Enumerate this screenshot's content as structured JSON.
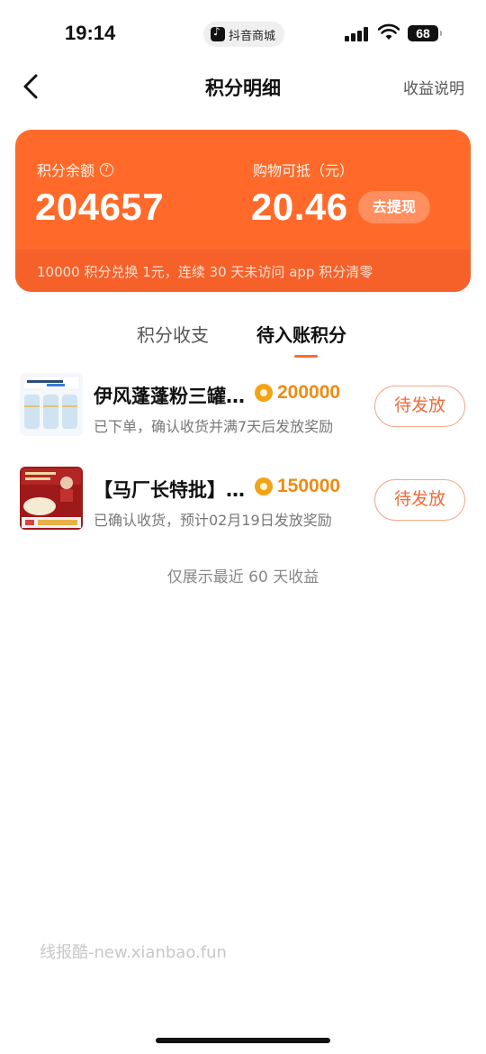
{
  "status_bar": {
    "time": "19:14",
    "app_pill": "抖音商城",
    "battery": "68"
  },
  "nav": {
    "title": "积分明细",
    "right_link": "收益说明"
  },
  "card": {
    "balance_label": "积分余额",
    "balance_value": "204657",
    "cash_label": "购物可抵（元）",
    "cash_value": "20.46",
    "withdraw_label": "去提现",
    "footnote": "10000 积分兑换 1元，连续 30 天未访问 app 积分清零"
  },
  "tabs": [
    {
      "label": "积分收支",
      "active": false
    },
    {
      "label": "待入账积分",
      "active": true
    }
  ],
  "items": [
    {
      "title": "伊风蓬蓬粉三罐装小蓝罐",
      "points": "200000",
      "subtitle": "已下单，确认收货并满7天后发放奖励",
      "button": "待发放"
    },
    {
      "title": "【马厂长特批】酸菜饺子",
      "points": "150000",
      "subtitle": "已确认收货，预计02月19日发放奖励",
      "button": "待发放"
    }
  ],
  "footer_note": "仅展示最近 60 天收益",
  "watermark": "线报酷-new.xianbao.fun",
  "colors": {
    "accent": "#ff6a2a",
    "points": "#f08a12",
    "coin": "#f2a417"
  }
}
